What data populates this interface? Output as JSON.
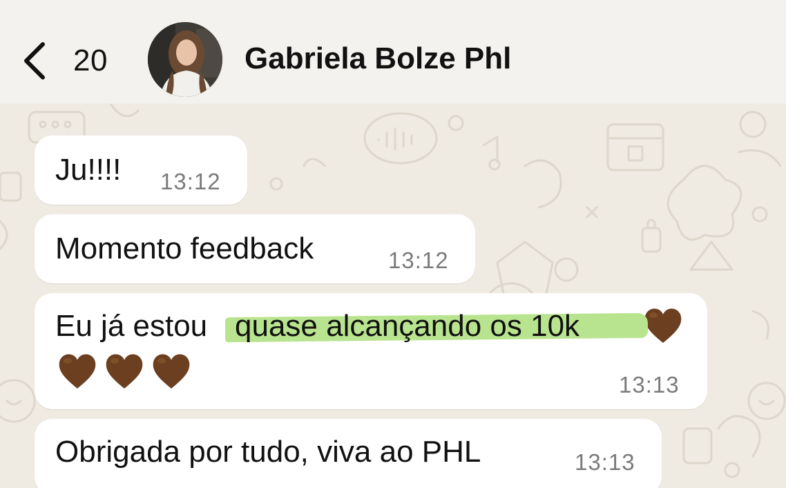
{
  "header": {
    "back_count": "20",
    "contact_name": "Gabriela Bolze Phl"
  },
  "messages": [
    {
      "text": "Ju!!!!",
      "time": "13:12"
    },
    {
      "text": "Momento feedback",
      "time": "13:12"
    },
    {
      "text_before": "Eu já estou",
      "text_highlighted": "quase alcançando os 10k",
      "emoji": "brown-heart",
      "emoji_count": 4,
      "time": "13:13"
    },
    {
      "text": "Obrigada por tudo, viva ao PHL",
      "time": "13:13"
    }
  ],
  "colors": {
    "wallpaper": "#efeae2",
    "bubble": "#ffffff",
    "highlight": "#b9e48f",
    "heart": "#6b3f1f"
  },
  "icons": [
    "back-chevron-icon",
    "brown-heart-icon"
  ]
}
